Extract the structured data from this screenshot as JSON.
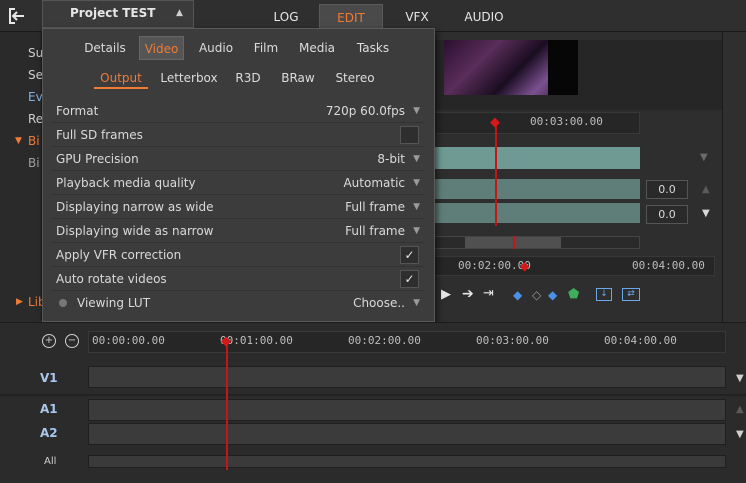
{
  "topbar": {
    "modes": [
      "LOG",
      "EDIT",
      "VFX",
      "AUDIO"
    ],
    "active_mode": "EDIT"
  },
  "left_panel": {
    "rows": [
      "Su",
      "Se",
      "Ev",
      "Re",
      "Bi",
      "Bi"
    ],
    "bottom_label": "Lib"
  },
  "project": {
    "title": "Project TEST"
  },
  "settings_tabs": [
    "Details",
    "Video",
    "Audio",
    "Film",
    "Media",
    "Tasks"
  ],
  "video_subtabs": [
    "Output",
    "Letterbox",
    "R3D",
    "BRaw",
    "Stereo"
  ],
  "settings": [
    {
      "label": "Format",
      "value": "720p 60.0fps",
      "type": "dropdown"
    },
    {
      "label": "Full SD frames",
      "value": "",
      "type": "checkbox",
      "checked": false
    },
    {
      "label": "GPU Precision",
      "value": "8-bit",
      "type": "dropdown"
    },
    {
      "label": "Playback media quality",
      "value": "Automatic",
      "type": "dropdown"
    },
    {
      "label": "Displaying narrow as wide",
      "value": "Full frame",
      "type": "dropdown"
    },
    {
      "label": "Displaying wide as narrow",
      "value": "Full frame",
      "type": "dropdown"
    },
    {
      "label": "Apply VFR correction",
      "value": "",
      "type": "checkbox",
      "checked": true
    },
    {
      "label": "Auto rotate videos",
      "value": "",
      "type": "checkbox",
      "checked": true
    },
    {
      "label": "Viewing LUT",
      "value": "Choose..",
      "type": "dropdown"
    }
  ],
  "viewer": {
    "ruler_top_tc": "00:03:00.00",
    "audio_levels": [
      "0.0",
      "0.0"
    ],
    "ruler_bottom": [
      "00:02:00.00",
      "00:04:00.00"
    ],
    "check_glyph": "✓"
  },
  "timeline": {
    "ruler": [
      "00:00:00.00",
      "00:01:00.00",
      "00:02:00.00",
      "00:03:00.00",
      "00:04:00.00"
    ],
    "tracks": [
      "V1",
      "A1",
      "A2"
    ],
    "all_label": "All"
  },
  "colors": {
    "accent": "#f07b35",
    "playhead": "#c81414",
    "track_label": "#a9c8f0"
  }
}
